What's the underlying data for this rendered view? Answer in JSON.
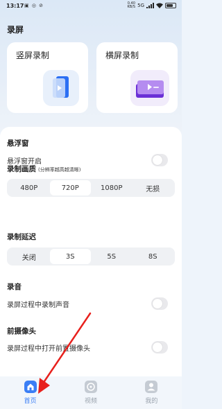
{
  "status_bar": {
    "time": "13:17",
    "left_icons": "▣ ◎ ⊘",
    "net_speed_value": "0.40",
    "net_speed_unit": "KB/S",
    "network": "5G"
  },
  "page": {
    "title": "录屏"
  },
  "modes": [
    {
      "label": "竖屏录制"
    },
    {
      "label": "横屏录制"
    }
  ],
  "floating_window": {
    "title": "悬浮窗",
    "toggle_label": "悬浮窗开启",
    "enabled": false
  },
  "quality": {
    "title": "录制画质",
    "subtitle": "(分辨率越高越清晰)",
    "options": [
      "480P",
      "720P",
      "1080P",
      "无损"
    ],
    "selected": "720P"
  },
  "delay": {
    "title": "录制延迟",
    "options": [
      "关闭",
      "3S",
      "5S",
      "8S"
    ],
    "selected": "3S"
  },
  "audio": {
    "title": "录音",
    "toggle_label": "录屏过程中录制声音",
    "enabled": false
  },
  "front_camera": {
    "title": "前摄像头",
    "toggle_label": "录屏过程中打开前置摄像头",
    "enabled": false
  },
  "bottom_nav": {
    "items": [
      {
        "label": "首页",
        "icon": "home-icon",
        "active": true
      },
      {
        "label": "视频",
        "icon": "video-icon",
        "active": false
      },
      {
        "label": "我的",
        "icon": "profile-icon",
        "active": false
      }
    ]
  },
  "colors": {
    "accent": "#3b7ef5",
    "annotation": "#e8201c"
  }
}
